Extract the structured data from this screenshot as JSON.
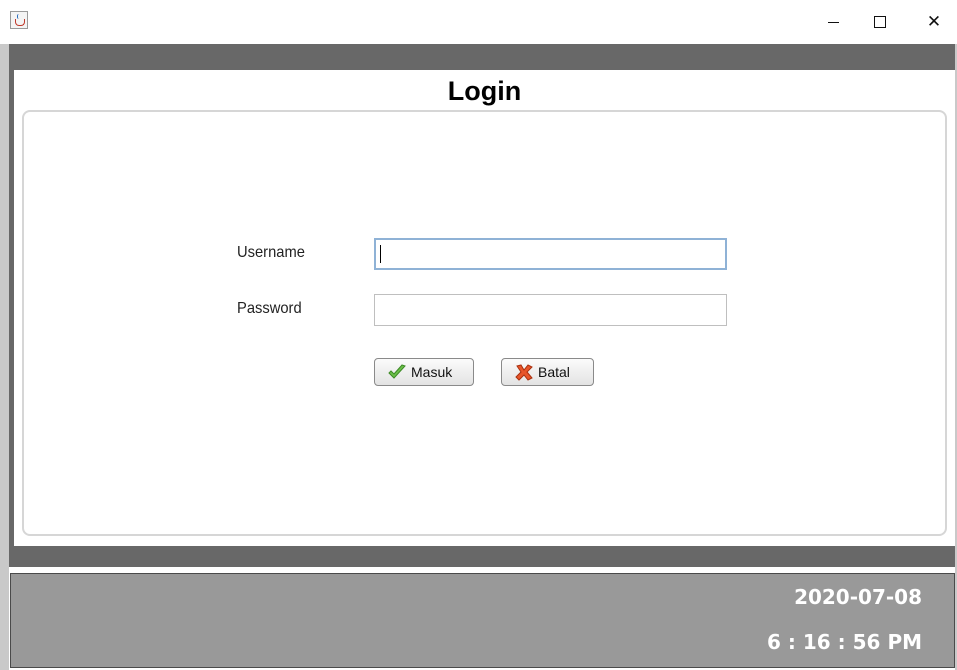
{
  "window": {
    "app_icon": "java-cup-icon",
    "controls": {
      "minimize_icon": "minimize-icon",
      "maximize_icon": "maximize-icon",
      "close_icon": "close-icon",
      "close_glyph": "✕"
    }
  },
  "header": {
    "title": "Login"
  },
  "form": {
    "username_label": "Username",
    "username_value": "",
    "password_label": "Password",
    "password_value": "",
    "submit_label": "Masuk",
    "submit_icon": "checkmark-icon",
    "cancel_label": "Batal",
    "cancel_icon": "x-mark-icon"
  },
  "footer": {
    "date": "2020-07-08",
    "time": "6 : 16 : 56 PM"
  },
  "colors": {
    "band": "#686868",
    "footer_bg": "#999999",
    "focus_border": "#8fb2d6"
  }
}
